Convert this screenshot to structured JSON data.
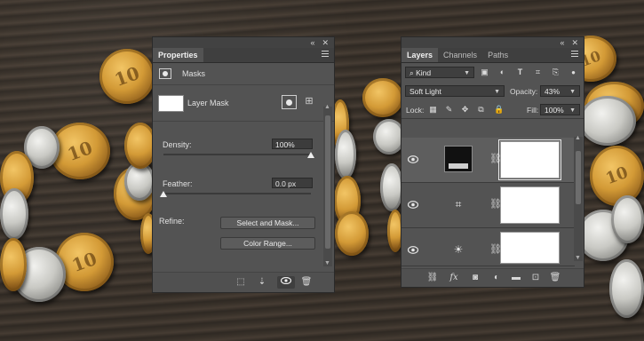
{
  "properties": {
    "tab": "Properties",
    "section": "Masks",
    "mask_label": "Layer Mask",
    "density": {
      "label": "Density:",
      "value": "100%",
      "level": 1.0
    },
    "feather": {
      "label": "Feather:",
      "value": "0.0 px",
      "level": 0.0
    },
    "refine_label": "Refine:",
    "buttons": {
      "select_and_mask": "Select and Mask...",
      "color_range": "Color Range..."
    }
  },
  "layers": {
    "tabs": [
      "Layers",
      "Channels",
      "Paths"
    ],
    "filter_kind": "Kind",
    "blend_mode": "Soft Light",
    "opacity_label": "Opacity:",
    "opacity_value": "43%",
    "lock_label": "Lock:",
    "fill_label": "Fill:",
    "fill_value": "100%"
  },
  "colors": {
    "panel_bg": "#535353",
    "panel_header": "#3f3f3f",
    "field_bg": "#3c3c3c",
    "text": "#e0e0e0"
  }
}
